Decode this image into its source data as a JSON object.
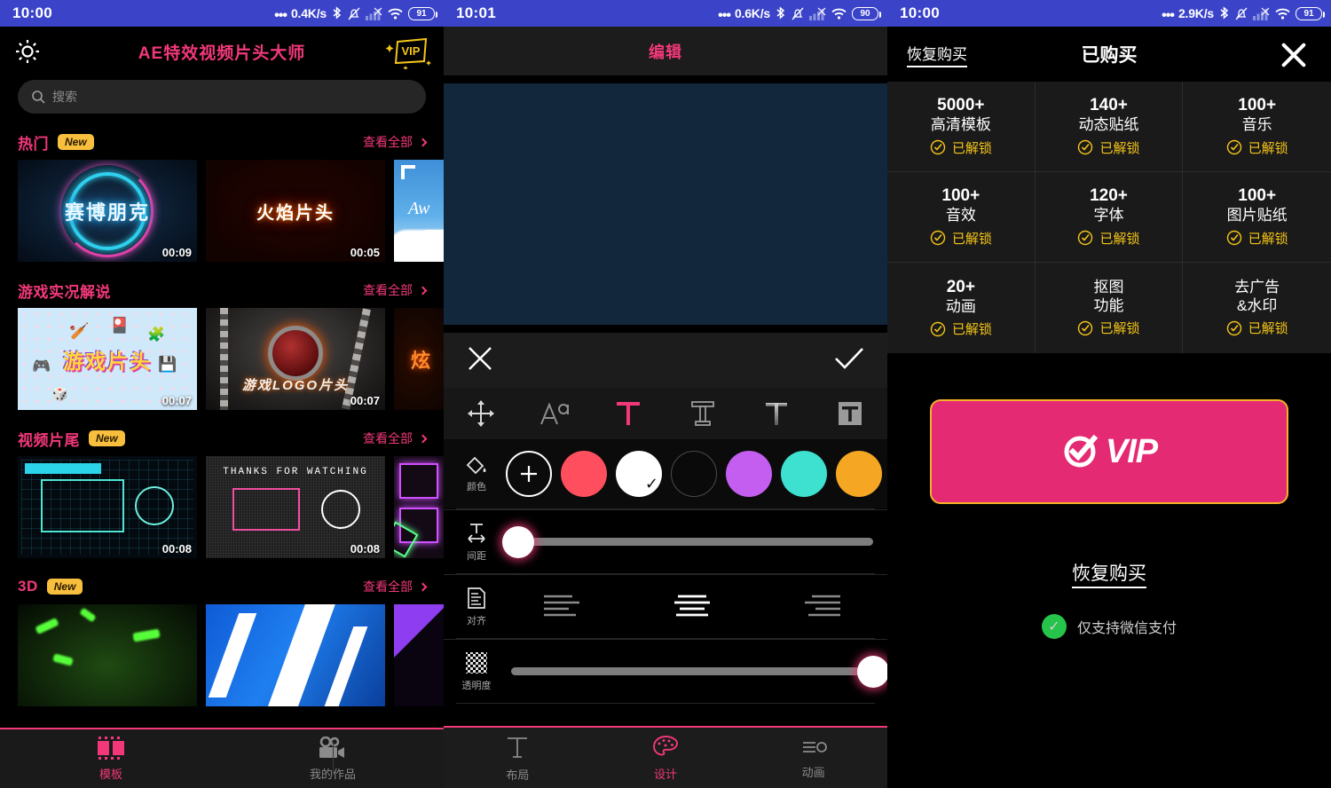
{
  "statusbars": [
    {
      "time": "10:00",
      "dots": "•••",
      "speed": "0.4K/s",
      "battery": "91",
      "icons": [
        "bluetooth-icon",
        "bell-muted-icon",
        "signal-bars-icon",
        "wifi-icon",
        "battery-icon"
      ]
    },
    {
      "time": "10:01",
      "dots": "•••",
      "speed": "0.6K/s",
      "battery": "90",
      "icons": [
        "bluetooth-icon",
        "bell-muted-icon",
        "signal-bars-icon",
        "wifi-icon",
        "battery-icon"
      ]
    },
    {
      "time": "10:00",
      "dots": "•••",
      "speed": "2.9K/s",
      "battery": "91",
      "icons": [
        "bluetooth-icon",
        "bell-muted-icon",
        "signal-bars-icon",
        "wifi-icon",
        "battery-icon"
      ]
    }
  ],
  "left": {
    "app_title": "AE特效视频片头大师",
    "title_color": "#f2387a",
    "gear_icon": "gear-icon",
    "vip_badge": "VIP",
    "search": {
      "placeholder": "搜索",
      "value": "",
      "icon": "search-icon"
    },
    "sections": [
      {
        "title": "热门",
        "badge": "New",
        "see_all": "查看全部",
        "cards": [
          {
            "label": "赛博朋克",
            "duration": "00:09",
            "style": "th-cyber"
          },
          {
            "label": "火焰片头",
            "duration": "00:05",
            "style": "th-fire"
          },
          {
            "label": "",
            "duration": "",
            "style": "th-sky"
          }
        ]
      },
      {
        "title": "游戏实况解说",
        "badge": "",
        "see_all": "查看全部",
        "cards": [
          {
            "label": "游戏片头",
            "duration": "00:07",
            "style": "th-game"
          },
          {
            "label": "游戏LOGO片头",
            "duration": "00:07",
            "style": "th-logo"
          },
          {
            "label": "炫",
            "duration": "",
            "style": "th-neon"
          }
        ]
      },
      {
        "title": "视频片尾",
        "badge": "New",
        "see_all": "查看全部",
        "cards": [
          {
            "label": "",
            "duration": "00:08",
            "style": "th-hud"
          },
          {
            "label": "THANKS FOR WATCHING",
            "duration": "00:08",
            "style": "th-thx"
          },
          {
            "label": "",
            "duration": "",
            "style": "th-pink"
          }
        ]
      },
      {
        "title": "3D",
        "badge": "New",
        "see_all": "查看全部",
        "cards": [
          {
            "label": "",
            "duration": "",
            "style": "th-green"
          },
          {
            "label": "",
            "duration": "",
            "style": "th-blue"
          },
          {
            "label": "",
            "duration": "",
            "style": "th-purp"
          }
        ]
      }
    ],
    "bottom_nav": [
      {
        "label": "模板",
        "icon": "film-icon",
        "active": true
      },
      {
        "label": "我的作品",
        "icon": "video-camera-icon",
        "active": false
      }
    ],
    "accent": "#f2387a",
    "badge_bg": "#f7bf3d"
  },
  "middle": {
    "title": "编辑",
    "canvas_color": "#12263c",
    "cancel_icon": "close-icon",
    "confirm_icon": "check-icon",
    "text_tools": [
      {
        "name": "move-tool-icon",
        "active": false
      },
      {
        "name": "font-tool-icon",
        "active": false
      },
      {
        "name": "text-color-tool-icon",
        "active": true
      },
      {
        "name": "text-stroke-tool-icon",
        "active": false
      },
      {
        "name": "text-shadow-tool-icon",
        "active": false
      },
      {
        "name": "text-background-tool-icon",
        "active": false
      }
    ],
    "color_row": {
      "label": "颜色",
      "label_icon": "paint-bucket-icon",
      "add_label": "+",
      "swatches": [
        {
          "hex": "#ff4f5e",
          "selected": false
        },
        {
          "hex": "#ffffff",
          "selected": true
        },
        {
          "hex": "#0a0a0a",
          "selected": false
        },
        {
          "hex": "#c35ef0",
          "selected": false
        },
        {
          "hex": "#3ee0d0",
          "selected": false
        },
        {
          "hex": "#f5a623",
          "selected": false
        }
      ]
    },
    "spacing_row": {
      "label": "间距",
      "icon": "line-spacing-icon",
      "value": 2
    },
    "align_row": {
      "label": "对齐",
      "icon": "align-doc-icon",
      "options": [
        {
          "name": "align-left-icon",
          "selected": false
        },
        {
          "name": "align-center-icon",
          "selected": true
        },
        {
          "name": "align-right-icon",
          "selected": false
        }
      ]
    },
    "opacity_row": {
      "label": "透明度",
      "icon": "checkerboard-icon",
      "value": 100
    },
    "bottom_nav": [
      {
        "label": "布局",
        "icon": "text-layout-icon",
        "active": false
      },
      {
        "label": "设计",
        "icon": "palette-icon",
        "active": true
      },
      {
        "label": "动画",
        "icon": "animation-icon",
        "active": false
      }
    ],
    "accent": "#f2387a"
  },
  "right": {
    "restore_top": "恢复购买",
    "title": "已购买",
    "close_icon": "close-icon",
    "features": [
      {
        "count": "5000+",
        "name": "高清模板",
        "status": "已解锁"
      },
      {
        "count": "140+",
        "name": "动态贴纸",
        "status": "已解锁"
      },
      {
        "count": "100+",
        "name": "音乐",
        "status": "已解锁"
      },
      {
        "count": "100+",
        "name": "音效",
        "status": "已解锁"
      },
      {
        "count": "120+",
        "name": "字体",
        "status": "已解锁"
      },
      {
        "count": "100+",
        "name": "图片贴纸",
        "status": "已解锁"
      },
      {
        "count": "20+",
        "name": "动画",
        "status": "已解锁"
      },
      {
        "count": "抠图",
        "name": "功能",
        "status": "已解锁"
      },
      {
        "count": "去广告",
        "name": "&水印",
        "status": "已解锁"
      }
    ],
    "vip_button": {
      "label": "VIP",
      "icon": "check-circle-icon",
      "bg": "#e42a72",
      "border": "#f5b12a"
    },
    "restore_bottom": "恢复购买",
    "payment_note": "仅支持微信支付",
    "payment_icon": "wechat-check-icon",
    "unlock_color": "#f5c518"
  }
}
